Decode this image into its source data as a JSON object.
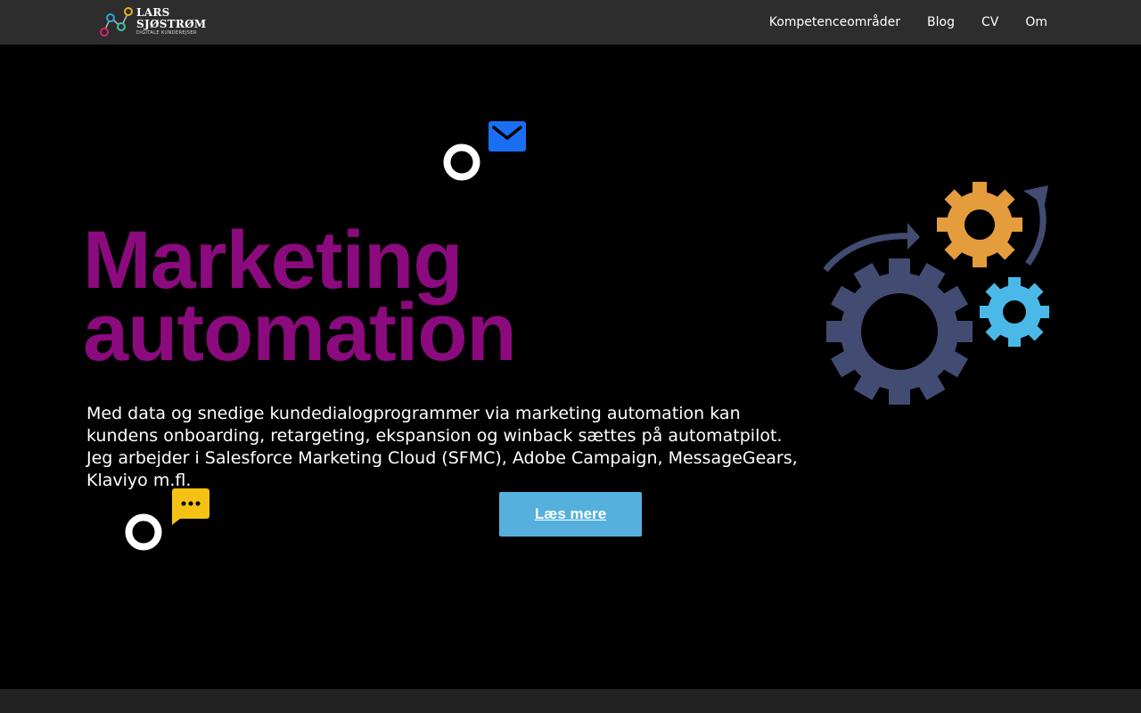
{
  "brand": {
    "name_line1": "LARS",
    "name_line2": "SJØSTRØM",
    "tagline": "DIGITALE KUNDEREJSER"
  },
  "nav": {
    "items": [
      {
        "label": "Kompetenceområder"
      },
      {
        "label": "Blog"
      },
      {
        "label": "CV"
      },
      {
        "label": "Om"
      }
    ]
  },
  "hero": {
    "title_line1": "Marketing",
    "title_line2": "automation",
    "description": "Med data og snedige kundedialogprogrammer via marketing automation kan kundens onboarding, retargeting, ekspansion og winback sættes på automatpilot. Jeg arbejder i Salesforce Marketing Cloud (SFMC), Adobe Campaign, MessageGears, Klaviyo m.fl.",
    "cta_label": "Læs mere"
  },
  "colors": {
    "title": "#8b0a7d",
    "cta": "#55b0de",
    "topbar": "#2d2d2d",
    "gear_large": "#424b72",
    "gear_orange": "#e59c3d",
    "gear_blue": "#4ab9e8",
    "mail_icon": "#1a6ef2",
    "chat_icon": "#f5c214"
  },
  "icons": [
    "logo-network-icon",
    "mail-icon",
    "chat-bubble-icon",
    "gears-illustration"
  ]
}
